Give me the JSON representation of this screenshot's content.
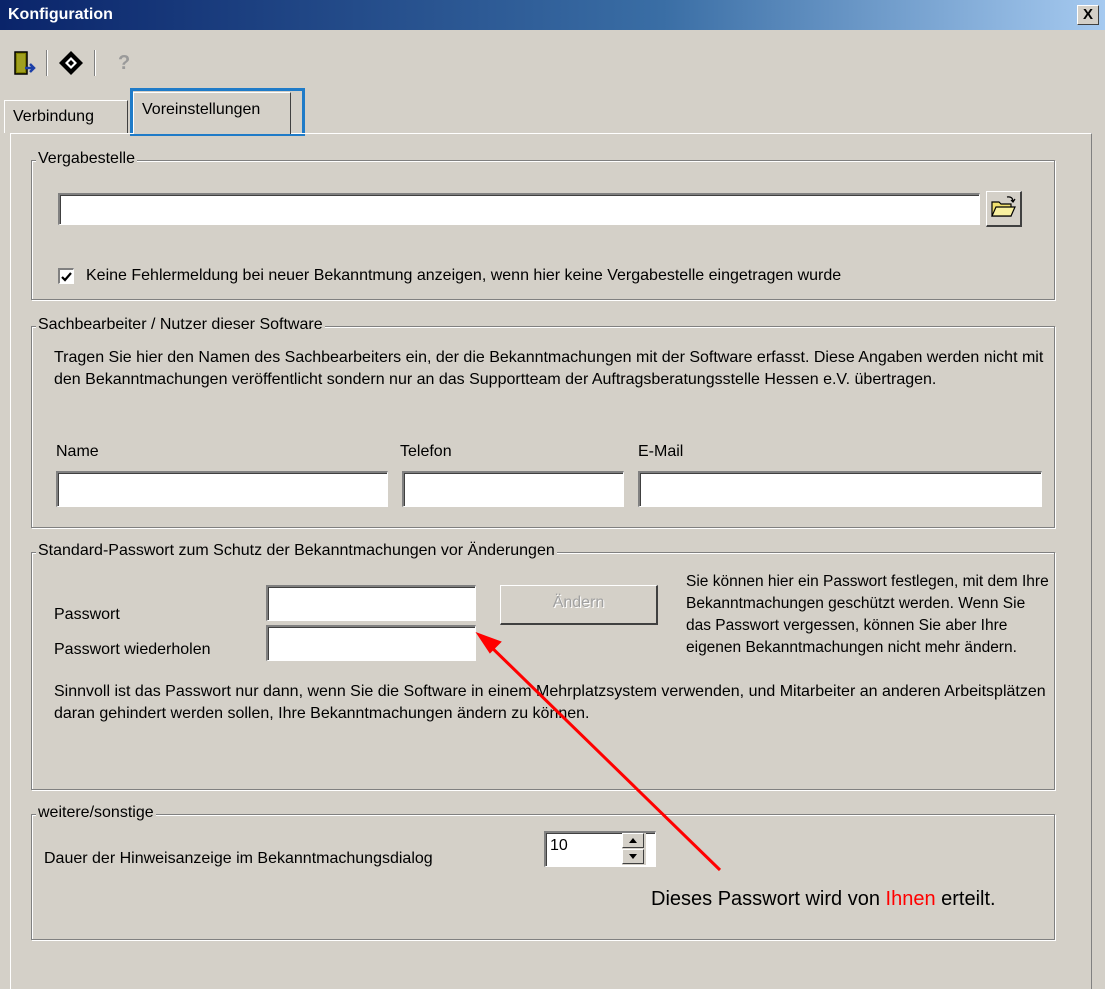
{
  "window": {
    "title": "Konfiguration",
    "close_glyph": "X"
  },
  "toolbar": {
    "icons": [
      "exit-door-icon",
      "diamond-icon",
      "help-question-icon"
    ],
    "help_glyph": "?"
  },
  "tabs": [
    {
      "label": "Verbindung",
      "selected": false
    },
    {
      "label": "Voreinstellungen",
      "selected": true
    }
  ],
  "vergabestelle": {
    "title": "Vergabestelle",
    "path_value": "",
    "browse_icon": "open-folder-icon",
    "checkbox_checked": true,
    "checkbox_label": "Keine Fehlermeldung bei neuer Bekanntmung anzeigen, wenn hier keine Vergabestelle eingetragen wurde"
  },
  "sachbearbeiter": {
    "title": "Sachbearbeiter / Nutzer dieser Software",
    "description": "Tragen Sie hier den Namen des Sachbearbeiters ein, der die Bekanntmachungen mit der Software erfasst. Diese Angaben werden nicht mit den Bekanntmachungen veröffentlicht sondern nur an das Supportteam der Auftragsberatungsstelle Hessen e.V. übertragen.",
    "name_label": "Name",
    "phone_label": "Telefon",
    "email_label": "E-Mail",
    "name_value": "",
    "phone_value": "",
    "email_value": ""
  },
  "passwort": {
    "title": "Standard-Passwort zum Schutz der Bekanntmachungen vor Änderungen",
    "password_label": "Passwort",
    "repeat_label": "Passwort wiederholen",
    "password_value": "",
    "repeat_value": "",
    "change_button": "Ändern",
    "change_enabled": false,
    "side_text": "Sie können hier ein Passwort festlegen, mit dem Ihre Bekanntmachungen geschützt werden. Wenn Sie das Passwort vergessen, können Sie aber Ihre eigenen Bekanntmachungen nicht mehr ändern.",
    "note": "Sinnvoll ist das Passwort nur dann, wenn Sie die Software in einem Mehrplatzsystem verwenden, und Mitarbeiter an anderen Arbeitsplätzen daran gehindert werden sollen, Ihre Bekanntmachungen ändern zu können."
  },
  "weitere": {
    "title": "weitere/sonstige",
    "duration_label": "Dauer der Hinweisanzeige im Bekanntmachungsdialog",
    "duration_value": "10"
  },
  "annotation": {
    "text_before": "Dieses Passwort wird von ",
    "text_highlight": "Ihnen",
    "text_after": " erteilt.",
    "arrow_color": "#ff0000",
    "highlight_color": "#ff0000"
  },
  "colors": {
    "tab_highlight_border": "#1f7bc8"
  }
}
